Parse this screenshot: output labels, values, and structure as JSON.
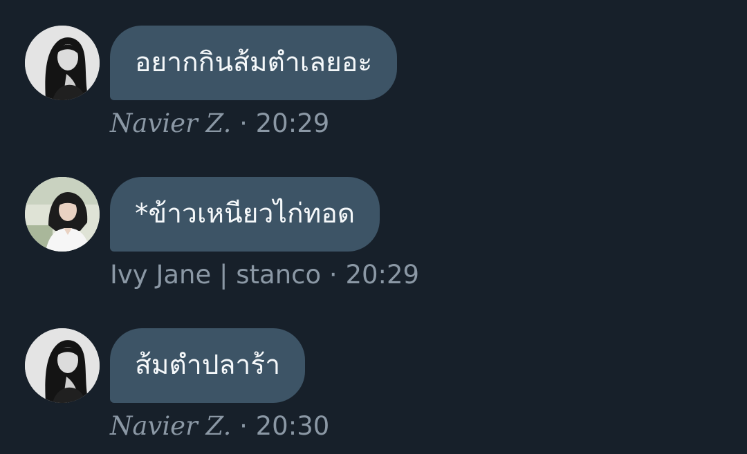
{
  "messages": [
    {
      "text": "อยากกินส้มตำเลยอะ",
      "sender": "Navier Z.",
      "separator": "·",
      "time": "20:29",
      "avatar_icon": "avatar-grayscale-woman"
    },
    {
      "text": "*ข้าวเหนียวไก่ทอด",
      "sender": "Ivy Jane | stanco",
      "separator": "·",
      "time": "20:29",
      "avatar_icon": "avatar-color-woman"
    },
    {
      "text": "ส้มตำปลาร้า",
      "sender": "Navier Z.",
      "separator": "·",
      "time": "20:30",
      "avatar_icon": "avatar-grayscale-woman"
    }
  ],
  "colors": {
    "background": "#17202a",
    "bubble": "#3d5466",
    "bubble_text": "#f5f8fa",
    "meta_text": "#8b98a5"
  }
}
